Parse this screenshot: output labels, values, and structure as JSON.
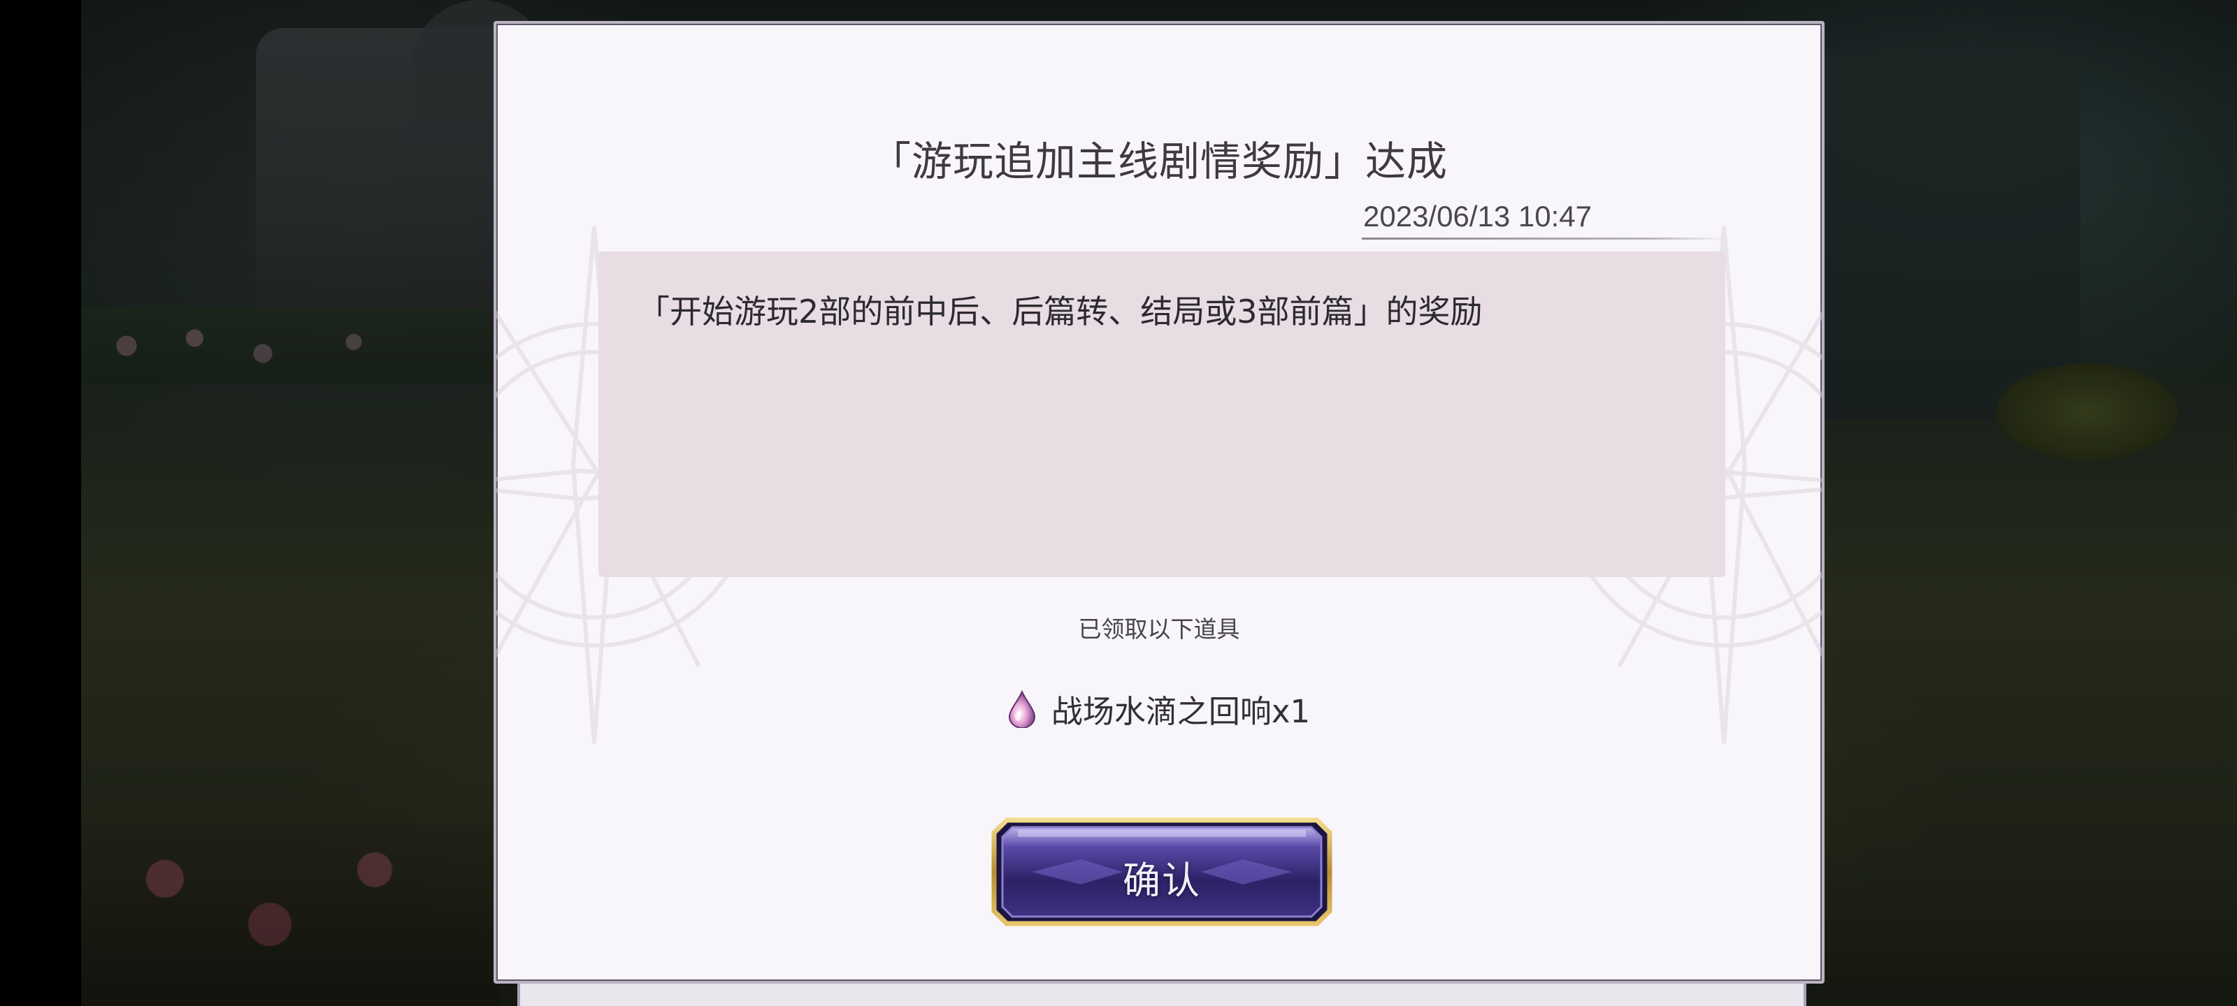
{
  "dialog": {
    "title": "「游玩追加主线剧情奖励」达成",
    "datetime": "2023/06/13 10:47",
    "message": "「开始游玩2部的前中后、后篇转、结局或3部前篇」的奖励",
    "received_label": "已领取以下道具",
    "reward": {
      "icon": "water-drop-icon",
      "name": "战场水滴之回响x1"
    },
    "confirm_label": "确认"
  },
  "colors": {
    "dialog_bg": "#f8f6fa",
    "message_box_bg": "#e7dde3",
    "button_gold": "#c9a650",
    "button_purple": "#3b2d7a"
  }
}
